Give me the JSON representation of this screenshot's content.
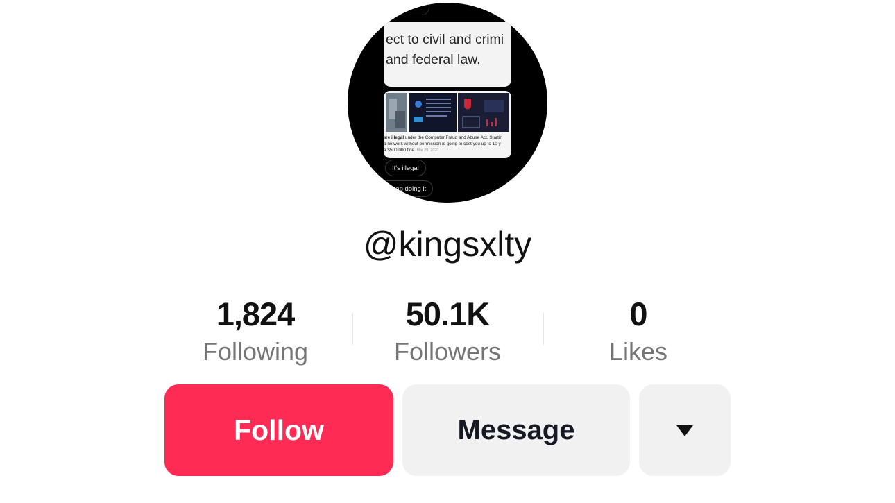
{
  "profile": {
    "username": "@kingsxlty",
    "avatar": {
      "description_icon": "profile-photo-screenshot",
      "bubble_text_line1": "ect to civil and crimi",
      "bubble_text_line2": "and federal law.",
      "card_text_line1_pre": "are ",
      "card_text_line1_bold": "illegal",
      "card_text_line1_post": " under the Computer Fraud and Abuse Act. Startin",
      "card_text_line2": "a network without permission is going to cost you up to 10 y",
      "card_text_line3": "a $500,000 fine.",
      "card_date": "Mar 29, 2020",
      "pill_1": "It's illegal",
      "pill_2": "o stop doing it"
    }
  },
  "stats": {
    "following": {
      "value": "1,824",
      "label": "Following"
    },
    "followers": {
      "value": "50.1K",
      "label": "Followers"
    },
    "likes": {
      "value": "0",
      "label": "Likes"
    }
  },
  "actions": {
    "follow_label": "Follow",
    "message_label": "Message",
    "more_icon": "caret-down-icon"
  },
  "colors": {
    "follow_button": "#fe2c55",
    "secondary_button": "#f1f1f2",
    "label_gray": "#757575",
    "text": "#111111"
  }
}
